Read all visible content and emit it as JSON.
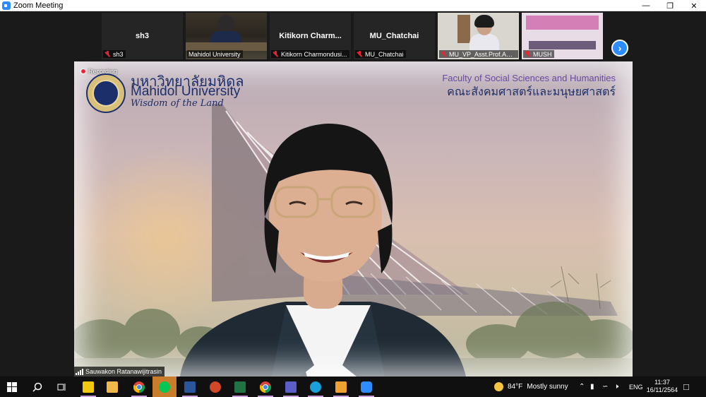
{
  "window": {
    "title": "Zoom Meeting",
    "controls": [
      "minimize-icon",
      "restore-icon",
      "close-icon"
    ]
  },
  "gallery": {
    "tiles": [
      {
        "big_name": "sh3",
        "label": "sh3",
        "muted": true
      },
      {
        "big_name": "",
        "label": "Mahidol University",
        "muted": false
      },
      {
        "big_name": "Kitikorn  Charm...",
        "label": "Kitikorn Charmondusi...",
        "muted": true
      },
      {
        "big_name": "MU_Chatchai",
        "label": "MU_Chatchai",
        "muted": true
      },
      {
        "big_name": "",
        "label": "MU_VP_Asst.Prof.Aue...",
        "muted": true
      },
      {
        "big_name": "",
        "label": "MUSH",
        "muted": true
      }
    ],
    "next_icon": "chevron-right-icon"
  },
  "main_video": {
    "recording_label": "Recording",
    "university_thai": "มหาวิทยาลัยมหิดล",
    "university_en": "Mahidol University",
    "motto": "Wisdom of the Land",
    "faculty_en": "Faculty of Social Sciences and Humanities",
    "faculty_thai": "คณะสังคมศาสตร์และมนุษยศาสตร์",
    "speaker_name": "Sauwakon Ratanawijitrasin"
  },
  "taskbar": {
    "apps": [
      "windows-start-icon",
      "search-icon",
      "task-view-icon",
      "sticky-notes-icon",
      "file-explorer-icon",
      "chrome-icon",
      "line-icon",
      "word-icon",
      "powerpoint-icon",
      "excel-icon",
      "chrome-profile-icon",
      "teams-icon",
      "edge-icon",
      "notes-app-icon",
      "zoom-icon"
    ],
    "weather_temp": "84°F",
    "weather_text": "Mostly sunny",
    "language": "ENG",
    "time": "11:37",
    "date": "16/11/2564"
  },
  "colors": {
    "zoom_blue": "#2d8cff",
    "mahidol_navy": "#1c2f6b",
    "taskbar_bg": "#101010"
  }
}
